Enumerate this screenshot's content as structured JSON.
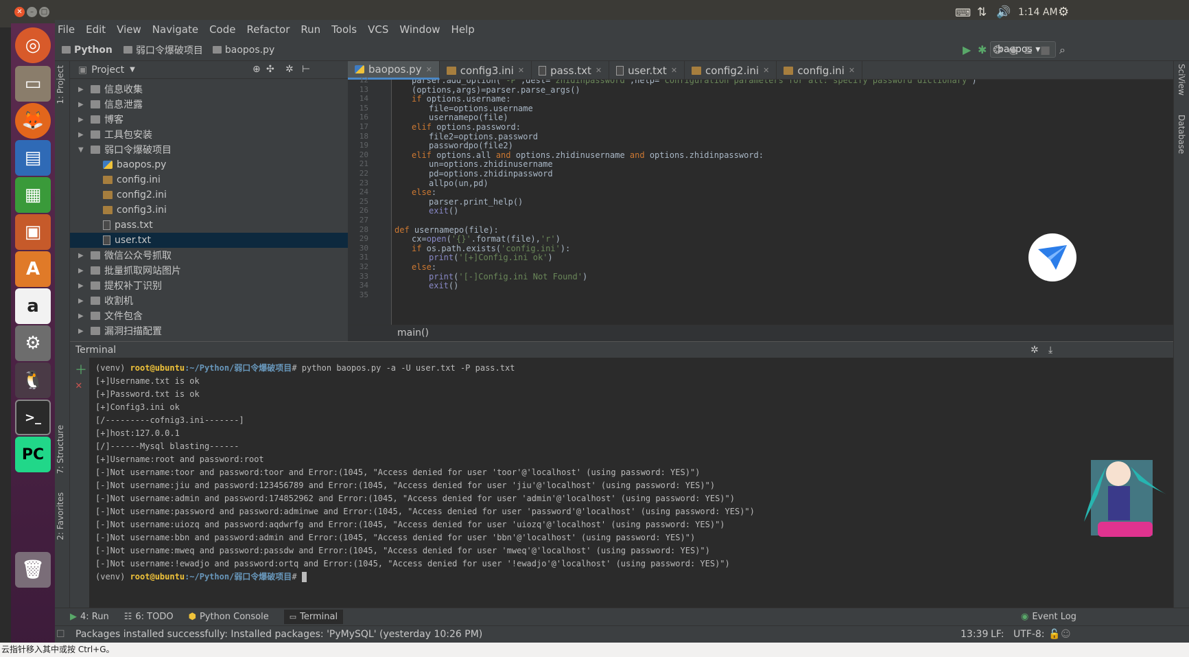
{
  "os": {
    "time": "1:14 AM"
  },
  "menu": [
    "File",
    "Edit",
    "View",
    "Navigate",
    "Code",
    "Refactor",
    "Run",
    "Tools",
    "VCS",
    "Window",
    "Help"
  ],
  "breadcrumb": [
    "Python",
    "弱口令爆破项目",
    "baopos.py"
  ],
  "toolbar": {
    "run_config": "baopos"
  },
  "side_tabs": {
    "project": "1: Project",
    "structure": "7: Structure",
    "favorites": "2: Favorites",
    "sciview": "SciView",
    "database": "Database"
  },
  "project_panel": {
    "title": "Project",
    "items": [
      {
        "label": "信息收集",
        "type": "folder",
        "level": 0,
        "expanded": false
      },
      {
        "label": "信息泄露",
        "type": "folder",
        "level": 0,
        "expanded": false
      },
      {
        "label": "博客",
        "type": "folder",
        "level": 0,
        "expanded": false
      },
      {
        "label": "工具包安装",
        "type": "folder",
        "level": 0,
        "expanded": false
      },
      {
        "label": "弱口令爆破项目",
        "type": "folder",
        "level": 0,
        "expanded": true
      },
      {
        "label": "baopos.py",
        "type": "py",
        "level": 1
      },
      {
        "label": "config.ini",
        "type": "ini",
        "level": 1
      },
      {
        "label": "config2.ini",
        "type": "ini",
        "level": 1
      },
      {
        "label": "config3.ini",
        "type": "ini",
        "level": 1
      },
      {
        "label": "pass.txt",
        "type": "txt",
        "level": 1
      },
      {
        "label": "user.txt",
        "type": "txt",
        "level": 1,
        "selected": true
      },
      {
        "label": "微信公众号抓取",
        "type": "folder",
        "level": 0,
        "expanded": false
      },
      {
        "label": "批量抓取网站图片",
        "type": "folder",
        "level": 0,
        "expanded": false
      },
      {
        "label": "提权补丁识别",
        "type": "folder",
        "level": 0,
        "expanded": false
      },
      {
        "label": "收割机",
        "type": "folder",
        "level": 0,
        "expanded": false
      },
      {
        "label": "文件包含",
        "type": "folder",
        "level": 0,
        "expanded": false
      },
      {
        "label": "漏洞扫描配置",
        "type": "folder",
        "level": 0,
        "expanded": false
      }
    ]
  },
  "editor": {
    "tabs": [
      {
        "label": "baopos.py",
        "icon": "py",
        "active": true
      },
      {
        "label": "config3.ini",
        "icon": "ini"
      },
      {
        "label": "pass.txt",
        "icon": "txt"
      },
      {
        "label": "user.txt",
        "icon": "txt"
      },
      {
        "label": "config2.ini",
        "icon": "ini"
      },
      {
        "label": "config.ini",
        "icon": "ini"
      }
    ],
    "lines": [
      {
        "n": "12",
        "indent": 1,
        "text": "parser.add_option('-P',dest='zhidinpassword',help='configuration parameters for all: specify password dictionary')"
      },
      {
        "n": "13",
        "indent": 1,
        "text": "(options,args)=parser.parse_args()"
      },
      {
        "n": "14",
        "indent": 1,
        "text": "if options.username:"
      },
      {
        "n": "15",
        "indent": 2,
        "text": "file=options.username"
      },
      {
        "n": "16",
        "indent": 2,
        "text": "usernamepo(file)"
      },
      {
        "n": "17",
        "indent": 1,
        "text": "elif options.password:"
      },
      {
        "n": "18",
        "indent": 2,
        "text": "file2=options.password"
      },
      {
        "n": "19",
        "indent": 2,
        "text": "passwordpo(file2)"
      },
      {
        "n": "20",
        "indent": 1,
        "text": "elif options.all and options.zhidinusername and options.zhidinpassword:"
      },
      {
        "n": "21",
        "indent": 2,
        "text": "un=options.zhidinusername"
      },
      {
        "n": "22",
        "indent": 2,
        "text": "pd=options.zhidinpassword"
      },
      {
        "n": "23",
        "indent": 2,
        "text": "allpo(un,pd)"
      },
      {
        "n": "24",
        "indent": 1,
        "text": "else:"
      },
      {
        "n": "25",
        "indent": 2,
        "text": "parser.print_help()"
      },
      {
        "n": "26",
        "indent": 2,
        "text": "exit()"
      },
      {
        "n": "27",
        "indent": 0,
        "text": ""
      },
      {
        "n": "28",
        "indent": 0,
        "text": "def usernamepo(file):"
      },
      {
        "n": "29",
        "indent": 1,
        "text": "cx=open('{}'.format(file),'r')"
      },
      {
        "n": "30",
        "indent": 1,
        "text": "if os.path.exists('config.ini'):"
      },
      {
        "n": "31",
        "indent": 2,
        "text": "print('[+]Config.ini ok')"
      },
      {
        "n": "32",
        "indent": 1,
        "text": "else:"
      },
      {
        "n": "33",
        "indent": 2,
        "text": "print('[-]Config.ini Not Found')"
      },
      {
        "n": "34",
        "indent": 2,
        "text": "exit()"
      },
      {
        "n": "35",
        "indent": 0,
        "text": ""
      }
    ],
    "breadcrumb": "main()"
  },
  "terminal": {
    "title": "Terminal",
    "prompt_env": "(venv) ",
    "prompt_user": "root@ubuntu",
    "prompt_path": ":~/Python/弱口令爆破项目",
    "command": "# python baopos.py -a -U user.txt -P pass.txt",
    "output": [
      "[+]Username.txt is ok",
      "[+]Password.txt is ok",
      "[+]Config3.ini ok",
      "[/---------cofnig3.ini-------]",
      "[+]host:127.0.0.1",
      "[/]------Mysql blasting------",
      "[+]Username:root and password:root",
      "[-]Not username:toor and password:toor and Error:(1045, \"Access denied for user 'toor'@'localhost' (using password: YES)\")",
      "[-]Not username:jiu and password:123456789 and Error:(1045, \"Access denied for user 'jiu'@'localhost' (using password: YES)\")",
      "[-]Not username:admin and password:174852962 and Error:(1045, \"Access denied for user 'admin'@'localhost' (using password: YES)\")",
      "[-]Not username:password and password:adminwe and Error:(1045, \"Access denied for user 'password'@'localhost' (using password: YES)\")",
      "[-]Not username:uiozq and password:aqdwrfg and Error:(1045, \"Access denied for user 'uiozq'@'localhost' (using password: YES)\")",
      "[-]Not username:bbn and password:admin and Error:(1045, \"Access denied for user 'bbn'@'localhost' (using password: YES)\")",
      "[-]Not username:mweq and password:passdw and Error:(1045, \"Access denied for user 'mweq'@'localhost' (using password: YES)\")",
      "[-]Not username:!ewadjo and password:ortq and Error:(1045, \"Access denied for user '!ewadjo'@'localhost' (using password: YES)\")"
    ],
    "final_prompt_suffix": "#"
  },
  "bottom_tabs": {
    "run": "4: Run",
    "todo": "6: TODO",
    "console": "Python Console",
    "terminal": "Terminal",
    "event_log": "Event Log"
  },
  "status": {
    "message": "Packages installed successfully: Installed packages: 'PyMySQL' (yesterday 10:26 PM)",
    "position": "13:39",
    "line_sep": "LF:",
    "encoding": "UTF-8:"
  },
  "ime": {
    "text": "云指针移入其中或按 Ctrl+G。"
  },
  "colors": {
    "accent": "#4a88c7",
    "keyword": "#cc7832",
    "string": "#6a8759",
    "prompt": "#f0c33a",
    "path": "#6897bb",
    "run_green": "#59a869",
    "error_red": "#c75450"
  }
}
